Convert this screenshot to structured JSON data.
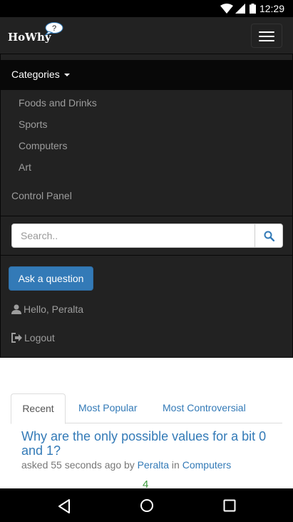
{
  "status_bar": {
    "time": "12:29"
  },
  "brand": {
    "name": "HoWhy",
    "bubble": "?"
  },
  "menu": {
    "categories_label": "Categories",
    "categories": [
      "Foods and Drinks",
      "Sports",
      "Computers",
      "Art"
    ],
    "control_panel": "Control Panel",
    "search_placeholder": "Search..",
    "ask_button": "Ask a question",
    "greeting": "Hello, Peralta",
    "logout": "Logout"
  },
  "tabs": [
    "Recent",
    "Most Popular",
    "Most Controversial"
  ],
  "question": {
    "title": "Why are the only possible values for a bit 0 and 1?",
    "asked_prefix": "asked 55 seconds ago by",
    "author": "Peralta",
    "in_word": "in",
    "category": "Computers",
    "votes": "4"
  },
  "colors": {
    "accent": "#337ab7",
    "navbar": "#222222",
    "vote": "#3c9a3c"
  }
}
